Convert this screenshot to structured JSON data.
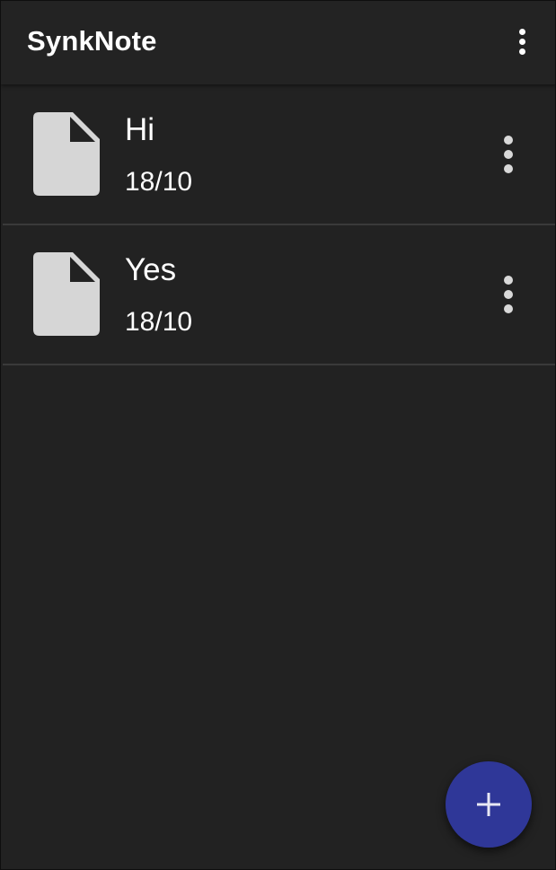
{
  "app_bar": {
    "title": "SynkNote",
    "menu_icon": "more-vert-icon"
  },
  "notes": [
    {
      "title": "Hi",
      "date": "18/10",
      "icon": "document-icon",
      "menu_icon": "more-vert-icon"
    },
    {
      "title": "Yes",
      "date": "18/10",
      "icon": "document-icon",
      "menu_icon": "more-vert-icon"
    }
  ],
  "fab": {
    "icon": "plus-icon",
    "color": "#2f3798"
  },
  "colors": {
    "background": "#222222",
    "app_bar": "#232323",
    "text": "#ffffff",
    "icon": "#d6d6d6",
    "divider": "#3a3a3a"
  }
}
